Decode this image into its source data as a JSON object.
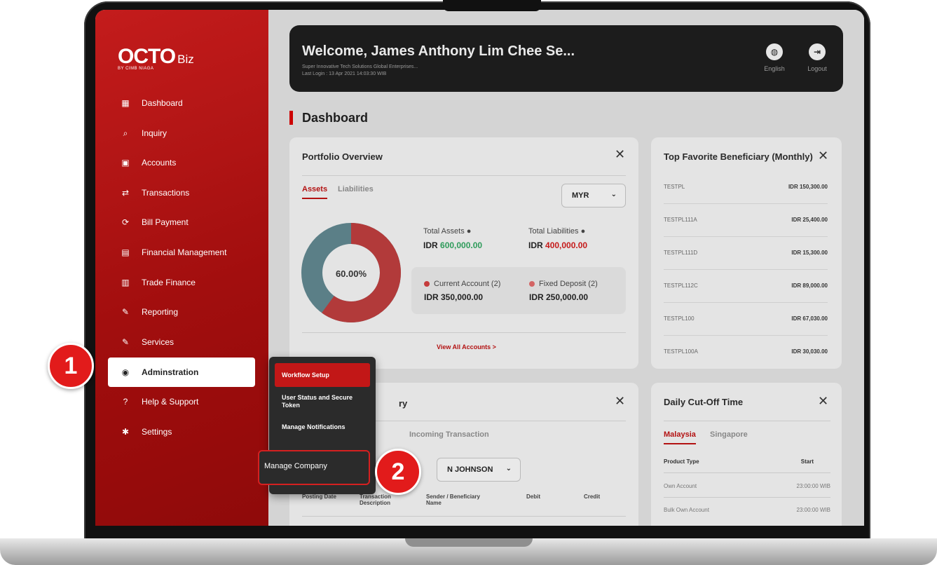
{
  "brand": {
    "name": "OCTO",
    "suffix": "Biz",
    "by": "BY CIMB NIAGA"
  },
  "sidebar": {
    "items": [
      {
        "label": "Dashboard",
        "icon": "dashboard-icon"
      },
      {
        "label": "Inquiry",
        "icon": "search-icon"
      },
      {
        "label": "Accounts",
        "icon": "wallet-icon"
      },
      {
        "label": "Transactions",
        "icon": "transfer-icon"
      },
      {
        "label": "Bill Payment",
        "icon": "bill-icon"
      },
      {
        "label": "Financial Management",
        "icon": "folder-plus-icon"
      },
      {
        "label": "Trade Finance",
        "icon": "bar-chart-icon"
      },
      {
        "label": "Reporting",
        "icon": "wrench-icon"
      },
      {
        "label": "Services",
        "icon": "wrench-icon"
      },
      {
        "label": "Adminstration",
        "icon": "user-circle-icon",
        "active": true
      },
      {
        "label": "Help & Support",
        "icon": "help-icon"
      },
      {
        "label": "Settings",
        "icon": "gear-icon"
      }
    ]
  },
  "header": {
    "welcome": "Welcome, James Anthony Lim Chee Se...",
    "company": "Super Innovative Tech Solutions Global Enterprises...",
    "last_login": "Last Login : 13 Apr 2021 14:03:30 WIB",
    "language_label": "English",
    "logout_label": "Logout"
  },
  "page": {
    "title": "Dashboard"
  },
  "portfolio": {
    "title": "Portfolio Overview",
    "tabs": [
      "Assets",
      "Liabilities"
    ],
    "currency": "MYR",
    "donut_percent": "60.00%",
    "donut_fraction": 0.6,
    "total_assets_label": "Total Assets",
    "total_assets_prefix": "IDR",
    "total_assets_value": "600,000.00",
    "total_liabilities_label": "Total Liabilities",
    "total_liabilities_prefix": "IDR",
    "total_liabilities_value": "400,000.00",
    "current_account_label": "Current Account (2)",
    "current_account_value": "IDR 350,000.00",
    "fixed_deposit_label": "Fixed Deposit (2)",
    "fixed_deposit_value": "IDR 250,000.00",
    "view_all": "View All Accounts >"
  },
  "beneficiary": {
    "title": "Top Favorite Beneficiary (Monthly)",
    "rows": [
      {
        "name": "TESTPL",
        "amount": "IDR 150,300.00"
      },
      {
        "name": "TESTPL111A",
        "amount": "IDR 25,400.00"
      },
      {
        "name": "TESTPL111D",
        "amount": "IDR 15,300.00"
      },
      {
        "name": "TESTPL112C",
        "amount": "IDR 89,000.00"
      },
      {
        "name": "TESTPL100",
        "amount": "IDR 67,030.00"
      },
      {
        "name": "TESTPL100A",
        "amount": "IDR 30,030.00"
      }
    ]
  },
  "history": {
    "title_suffix": "ry",
    "tab_incoming": "Incoming Transaction",
    "select_value": "N JOHNSON",
    "columns": [
      "Posting Date",
      "Transaction Description",
      "Sender / Beneficiary Name",
      "Debit",
      "Credit"
    ]
  },
  "cutoff": {
    "title": "Daily Cut-Off Time",
    "tabs": [
      "Malaysia",
      "Singapore"
    ],
    "col_product": "Product Type",
    "col_start": "Start",
    "rows": [
      {
        "product": "Own Account",
        "start": "23:00:00 WIB"
      },
      {
        "product": "Bulk Own Account",
        "start": "23:00:00 WIB"
      }
    ]
  },
  "popup": {
    "items": [
      "Workflow Setup",
      "User Status and Secure Token",
      "Manage Notifications"
    ],
    "highlight": "Manage Company"
  },
  "badges": [
    "1",
    "2"
  ],
  "colors": {
    "brand_red": "#c21717",
    "asset_green": "#2e9b5a",
    "donut_teal": "#5b7f87"
  }
}
